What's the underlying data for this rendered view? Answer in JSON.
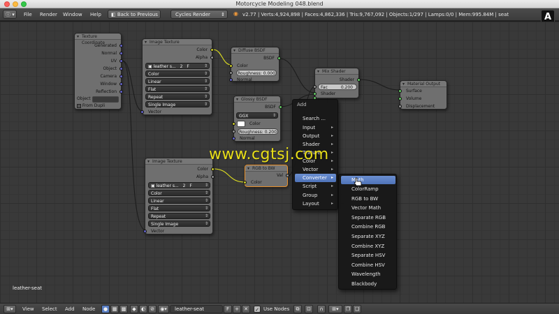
{
  "window": {
    "title": "Motorcycle Modeling 048.blend"
  },
  "info_header": {
    "editor_icon": "info-icon",
    "menus": [
      "File",
      "Render",
      "Window",
      "Help"
    ],
    "back_button": "Back to Previous",
    "render_engine": "Cycles Render",
    "stats": "v2.77 | Verts:4,924,898 | Faces:4,862,336 | Tris:9,767,092 | Objects:1/297 | Lamps:0/0 | Mem:995.84M | seat"
  },
  "badge": "A",
  "watermark": "www.cgtsj.com",
  "canvas": {
    "material_label": "leather-seat"
  },
  "nodes": {
    "texture_coordinate": {
      "title": "Texture Coordinate",
      "outputs": [
        "Generated",
        "Normal",
        "UV",
        "Object",
        "Camera",
        "Window",
        "Reflection"
      ],
      "object_label": "Object",
      "from_dupli": "From Dupli"
    },
    "image_texture_1": {
      "title": "Image Texture",
      "outputs": [
        "Color",
        "Alpha"
      ],
      "image_name": "leather s...",
      "users": "2",
      "fake_user": "F",
      "dropdowns": [
        "Color",
        "Linear",
        "Flat",
        "Repeat",
        "Single Image"
      ],
      "input": "Vector"
    },
    "diffuse_bsdf": {
      "title": "Diffuse BSDF",
      "output": "BSDF",
      "inputs": [
        "Color",
        "Roughness: 0.000",
        "Normal"
      ]
    },
    "glossy_bsdf": {
      "title": "Glossy BSDF",
      "output": "BSDF",
      "distribution": "GGX",
      "inputs": [
        "Color",
        "Roughness: 0.200",
        "Normal"
      ]
    },
    "mix_shader": {
      "title": "Mix Shader",
      "output": "Shader",
      "fac_label": "Fac",
      "fac_value": "0.200",
      "inputs": [
        "Shader",
        "Shader"
      ]
    },
    "material_output": {
      "title": "Material Output",
      "inputs": [
        "Surface",
        "Volume",
        "Displacement"
      ]
    },
    "image_texture_2": {
      "title": "Image Texture",
      "outputs": [
        "Color",
        "Alpha"
      ],
      "image_name": "leather s...",
      "users": "2",
      "fake_user": "F",
      "dropdowns": [
        "Color",
        "Linear",
        "Flat",
        "Repeat",
        "Single Image"
      ],
      "input": "Vector"
    },
    "rgb_to_bw": {
      "title": "RGB to BW",
      "output": "Val",
      "input": "Color"
    }
  },
  "add_menu": {
    "title": "Add",
    "items": [
      "Search ...",
      "Input",
      "Output",
      "Shader",
      "Texture",
      "Color",
      "Vector",
      "Converter",
      "Script",
      "Group",
      "Layout"
    ],
    "highlighted": "Converter"
  },
  "converter_menu": {
    "items": [
      "Math",
      "ColorRamp",
      "RGB to BW",
      "Vector Math",
      "Separate RGB",
      "Combine RGB",
      "Separate XYZ",
      "Combine XYZ",
      "Separate HSV",
      "Combine HSV",
      "Wavelength",
      "Blackbody"
    ],
    "highlighted": "Math"
  },
  "bottom_bar": {
    "menus": [
      "View",
      "Select",
      "Add",
      "Node"
    ],
    "material_name": "leather-seat",
    "fake_user": "F",
    "use_nodes": "Use Nodes"
  },
  "colors": {
    "canvas_bg": "#393939",
    "node_bg": "#6f6f6f",
    "socket_color": "#c7c729",
    "socket_shader": "#63c763",
    "socket_vector": "#6363c7",
    "menu_highlight": "#5a7fc4",
    "watermark": "#e9df18"
  }
}
